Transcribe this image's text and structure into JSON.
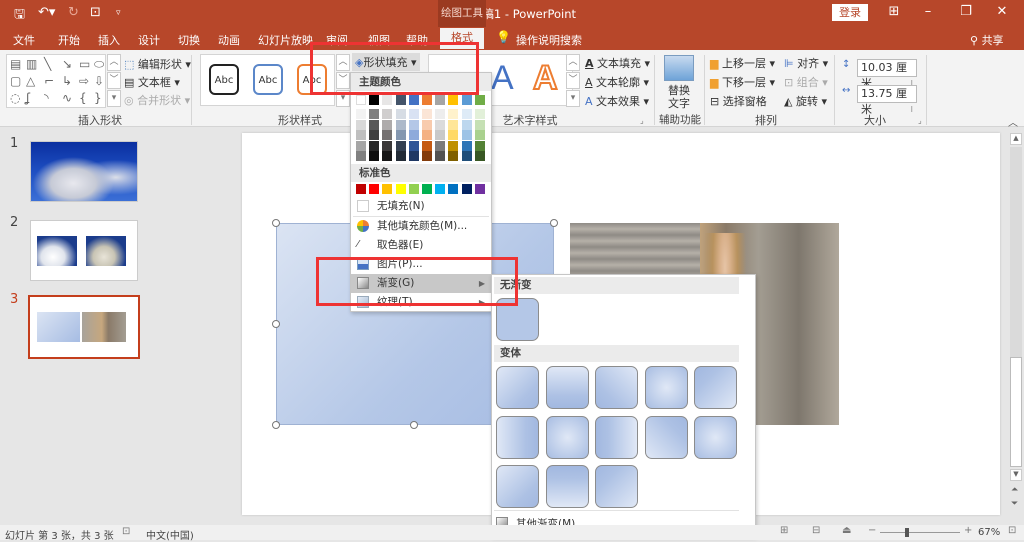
{
  "titlebar": {
    "title": "演示文稿1  -  PowerPoint",
    "context_tools": "绘图工具",
    "login_label": "登录",
    "icons": [
      "save-icon",
      "undo-icon",
      "redo-icon",
      "present-icon",
      "customize-icon"
    ]
  },
  "tabs": [
    {
      "label": "文件"
    },
    {
      "label": "开始"
    },
    {
      "label": "插入"
    },
    {
      "label": "设计"
    },
    {
      "label": "切换"
    },
    {
      "label": "动画"
    },
    {
      "label": "幻灯片放映"
    },
    {
      "label": "审阅"
    },
    {
      "label": "视图"
    },
    {
      "label": "帮助"
    },
    {
      "label": "格式",
      "active": true
    }
  ],
  "tell_me": "操作说明搜索",
  "share_label": "共享",
  "ribbon": {
    "insert_shapes": {
      "label": "插入形状",
      "edit_shape": "编辑形状",
      "text_box": "文本框",
      "merge_shapes": "合并形状"
    },
    "shape_styles": {
      "label": "形状样式",
      "style_sample": "Abc",
      "shape_fill": "形状填充"
    },
    "wordart": {
      "label": "艺术字样式",
      "text_fill": "文本填充",
      "text_outline": "文本轮廓",
      "text_effects": "文本效果",
      "sample": "A"
    },
    "accessibility": {
      "label": "辅助功能",
      "alt_text_line1": "替换",
      "alt_text_line2": "文字"
    },
    "arrange": {
      "label": "排列",
      "bring_forward": "上移一层",
      "send_backward": "下移一层",
      "selection_pane": "选择窗格",
      "align": "对齐",
      "group": "组合",
      "rotate": "旋转"
    },
    "size": {
      "label": "大小",
      "height": "10.03 厘米",
      "width": "13.75 厘米"
    }
  },
  "slides": [
    {
      "number": "1",
      "content": "sky-clouds"
    },
    {
      "number": "2",
      "content": "two-cloud-images"
    },
    {
      "number": "3",
      "content": "gradient-rect-and-photo",
      "selected": true
    }
  ],
  "fill_menu": {
    "theme_colors_label": "主题颜色",
    "theme_colors_top": [
      "#ffffff",
      "#000000",
      "#e7e6e6",
      "#44546a",
      "#4472c4",
      "#ed7d31",
      "#a5a5a5",
      "#ffc000",
      "#5b9bd5",
      "#70ad47"
    ],
    "theme_colors_shades": [
      [
        "#f2f2f2",
        "#d9d9d9",
        "#bfbfbf",
        "#a6a6a6",
        "#808080"
      ],
      [
        "#808080",
        "#595959",
        "#404040",
        "#262626",
        "#0d0d0d"
      ],
      [
        "#d0cece",
        "#aeabab",
        "#757171",
        "#3a3838",
        "#171616"
      ],
      [
        "#d6dce4",
        "#adb9ca",
        "#8497b0",
        "#333f50",
        "#222a35"
      ],
      [
        "#d9e2f3",
        "#b4c7e7",
        "#8eaadb",
        "#2f5597",
        "#1f3864"
      ],
      [
        "#fbe5d6",
        "#f8cbad",
        "#f4b183",
        "#c55a11",
        "#843c0c"
      ],
      [
        "#ededed",
        "#dbdbdb",
        "#c9c9c9",
        "#7b7b7b",
        "#525252"
      ],
      [
        "#fff2cc",
        "#ffe699",
        "#ffd966",
        "#bf9000",
        "#7f6000"
      ],
      [
        "#deebf7",
        "#bdd7ee",
        "#9dc3e6",
        "#2e75b6",
        "#1f4e79"
      ],
      [
        "#e2f0d9",
        "#c5e0b4",
        "#a9d18e",
        "#548235",
        "#385723"
      ]
    ],
    "standard_colors_label": "标准色",
    "standard_colors": [
      "#c00000",
      "#ff0000",
      "#ffc000",
      "#ffff00",
      "#92d050",
      "#00b050",
      "#00b0f0",
      "#0070c0",
      "#002060",
      "#7030a0"
    ],
    "items": [
      {
        "label": "无填充(N)",
        "icon": "no-fill-icon"
      },
      {
        "label": "其他填充颜色(M)...",
        "icon": "color-wheel-icon"
      },
      {
        "label": "取色器(E)",
        "icon": "eyedropper-icon"
      },
      {
        "label": "图片(P)...",
        "icon": "picture-icon"
      },
      {
        "label": "渐变(G)",
        "icon": "gradient-icon",
        "submenu": true,
        "highlighted": true
      },
      {
        "label": "纹理(T)",
        "icon": "texture-icon",
        "submenu": true
      }
    ]
  },
  "gradient_menu": {
    "no_gradient_label": "无渐变",
    "variants_label": "变体",
    "more_gradients": "其他渐变(M)...",
    "variant_count": 13
  },
  "statusbar": {
    "slide_info": "幻灯片 第 3 张，共 3 张",
    "language": "中文(中国)",
    "zoom": "67%",
    "zoom_fraction": 0.67
  }
}
